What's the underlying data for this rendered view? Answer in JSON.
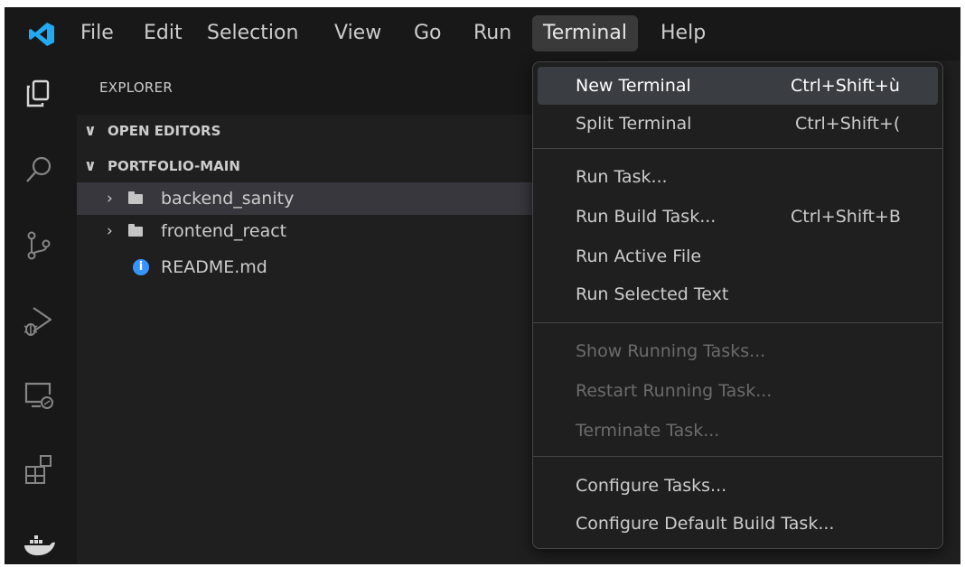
{
  "menubar": {
    "items": [
      "File",
      "Edit",
      "Selection",
      "View",
      "Go",
      "Run",
      "Terminal",
      "Help"
    ],
    "active": "Terminal"
  },
  "explorer": {
    "title": "EXPLORER",
    "open_editors": "OPEN EDITORS",
    "folder": "PORTFOLIO-MAIN",
    "files": [
      {
        "name": "backend_sanity",
        "type": "folder",
        "selected": true
      },
      {
        "name": "frontend_react",
        "type": "folder",
        "selected": false
      },
      {
        "name": "README.md",
        "type": "info-file",
        "selected": false
      }
    ]
  },
  "activitybar": {
    "icons": [
      "explorer-icon",
      "search-icon",
      "source-control-icon",
      "run-debug-icon",
      "remote-explorer-icon",
      "extensions-icon",
      "docker-icon"
    ]
  },
  "terminal_menu": {
    "groups": [
      [
        {
          "label": "New Terminal",
          "shortcut": "Ctrl+Shift+ù",
          "state": "hover"
        },
        {
          "label": "Split Terminal",
          "shortcut": "Ctrl+Shift+(",
          "state": "normal"
        }
      ],
      [
        {
          "label": "Run Task...",
          "shortcut": "",
          "state": "normal"
        },
        {
          "label": "Run Build Task...",
          "shortcut": "Ctrl+Shift+B",
          "state": "normal"
        },
        {
          "label": "Run Active File",
          "shortcut": "",
          "state": "normal"
        },
        {
          "label": "Run Selected Text",
          "shortcut": "",
          "state": "normal"
        }
      ],
      [
        {
          "label": "Show Running Tasks...",
          "shortcut": "",
          "state": "disabled"
        },
        {
          "label": "Restart Running Task...",
          "shortcut": "",
          "state": "disabled"
        },
        {
          "label": "Terminate Task...",
          "shortcut": "",
          "state": "disabled"
        }
      ],
      [
        {
          "label": "Configure Tasks...",
          "shortcut": "",
          "state": "normal"
        },
        {
          "label": "Configure Default Build Task...",
          "shortcut": "",
          "state": "normal"
        }
      ]
    ]
  },
  "colors": {
    "background": "#1f1f1f",
    "titlebar": "#181818",
    "text": "#cccccc",
    "disabled_text": "#6b6b6b",
    "accent": "#3794ff",
    "vscode_blue": "#23a9f2",
    "hover": "#3a3d41"
  }
}
